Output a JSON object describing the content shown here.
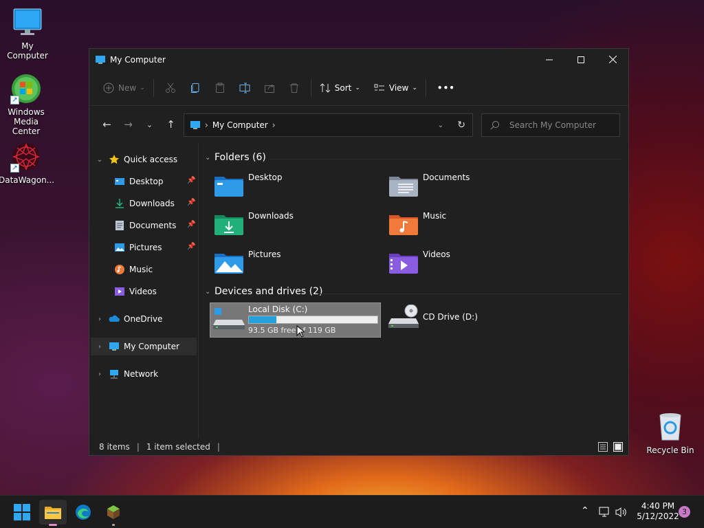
{
  "desktop": {
    "icons": [
      {
        "label": "My Computer"
      },
      {
        "label": "Windows Media Center"
      },
      {
        "label": "DataWagon..."
      },
      {
        "label": "Recycle Bin"
      }
    ]
  },
  "window": {
    "title": "My Computer",
    "toolbar": {
      "new_label": "New",
      "sort_label": "Sort",
      "view_label": "View",
      "more_label": "•••"
    },
    "address": {
      "crumb": "My Computer"
    },
    "search": {
      "placeholder": "Search My Computer"
    },
    "sidebar": {
      "quick_access": "Quick access",
      "items": [
        {
          "label": "Desktop",
          "pinned": true
        },
        {
          "label": "Downloads",
          "pinned": true
        },
        {
          "label": "Documents",
          "pinned": true
        },
        {
          "label": "Pictures",
          "pinned": true
        },
        {
          "label": "Music",
          "pinned": false
        },
        {
          "label": "Videos",
          "pinned": false
        }
      ],
      "onedrive": "OneDrive",
      "my_computer": "My Computer",
      "network": "Network"
    },
    "content": {
      "folders_header": "Folders (6)",
      "folders": [
        {
          "label": "Desktop"
        },
        {
          "label": "Documents"
        },
        {
          "label": "Downloads"
        },
        {
          "label": "Music"
        },
        {
          "label": "Pictures"
        },
        {
          "label": "Videos"
        }
      ],
      "drives_header": "Devices and drives (2)",
      "drives": [
        {
          "label": "Local Disk (C:)",
          "free_text": "93.5 GB free of 119 GB",
          "used_fraction": 0.214
        },
        {
          "label": "CD Drive (D:)"
        }
      ]
    },
    "status": {
      "items": "8 items",
      "selected": "1 item selected"
    }
  },
  "taskbar": {
    "time": "4:40 PM",
    "date": "5/12/2022",
    "notification_count": "3"
  },
  "colors": {
    "accent": "#0a84d8",
    "folder_blue": "#2f9ae8",
    "folder_green": "#21b07a",
    "folder_orange": "#f07a3a",
    "folder_purple": "#8a5ce0",
    "window_bg": "#202020"
  }
}
